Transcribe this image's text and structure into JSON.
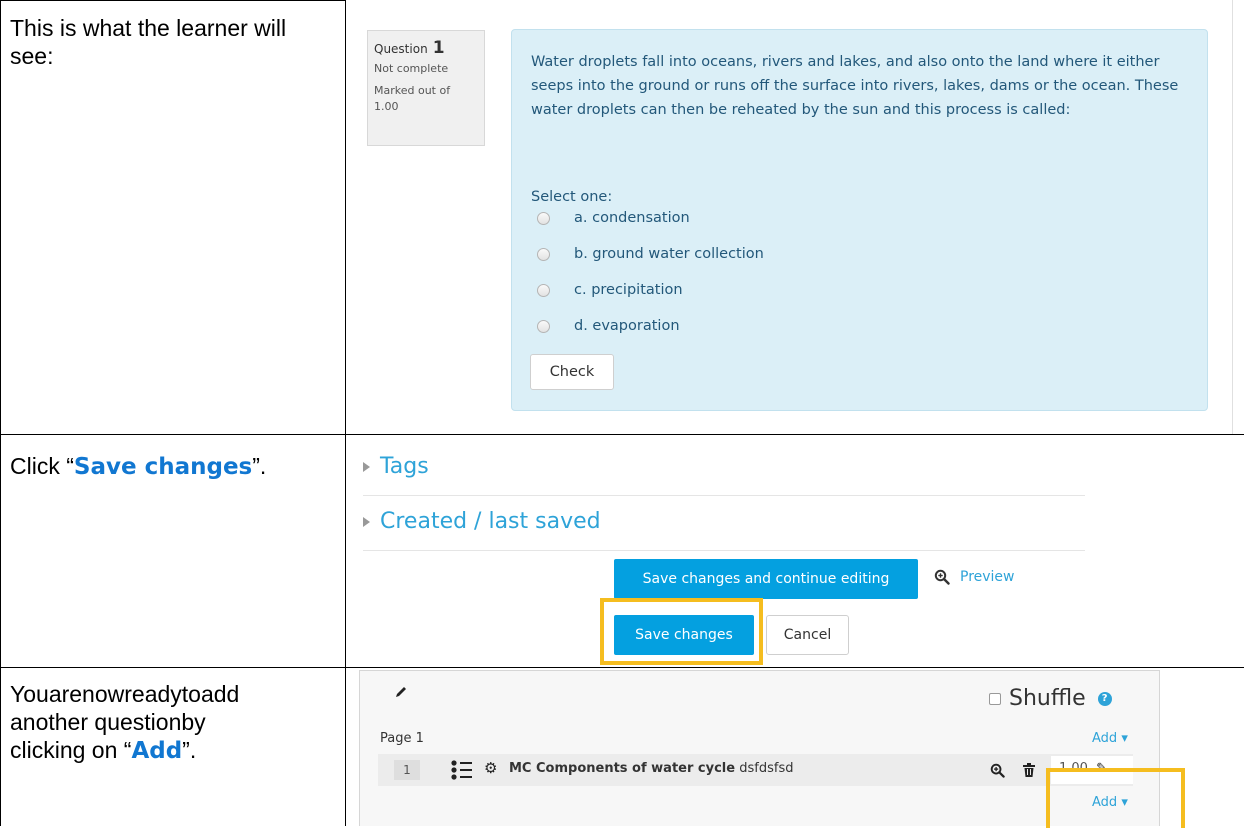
{
  "row1": {
    "instruction": "This is what the learner will see:",
    "question_label": "Question",
    "question_number": "1",
    "status": "Not complete",
    "marked_out_of": "Marked out of 1.00",
    "question_text": "Water droplets fall into oceans, rivers and lakes, and also onto the land where it either seeps into the ground or runs off the surface into rivers, lakes, dams or the ocean. These water droplets can then be reheated by the sun and this process is called:",
    "select_one": "Select one:",
    "options": [
      "a. condensation",
      "b. ground water collection",
      "c. precipitation",
      "d. evaporation"
    ],
    "check_label": "Check"
  },
  "row2": {
    "instruction_pre": "Click “",
    "instruction_bold": "Save changes",
    "instruction_post": "”.",
    "tags": "Tags",
    "created": "Created / last saved",
    "save_continue": "Save changes and continue editing",
    "preview": "Preview",
    "save_changes": "Save changes",
    "cancel": "Cancel"
  },
  "row3": {
    "instruction_line1": "Youarenowreadytoadd",
    "instruction_line2": "another questionby",
    "instruction_line3_pre": "clicking on “",
    "instruction_line3_bold": "Add",
    "instruction_line3_post": "”.",
    "shuffle": "Shuffle",
    "page": "Page 1",
    "add": "Add",
    "slot_number": "1",
    "question_name": "MC Components of water cycle",
    "question_desc": "dsfdsfsd",
    "mark": "1.00"
  },
  "colors": {
    "question_box": "#dbeff7",
    "primary_button": "#04a0e0",
    "highlight": "#f5bd1f",
    "link": "#2ea3d8",
    "instruction_bold": "#1177d1"
  }
}
